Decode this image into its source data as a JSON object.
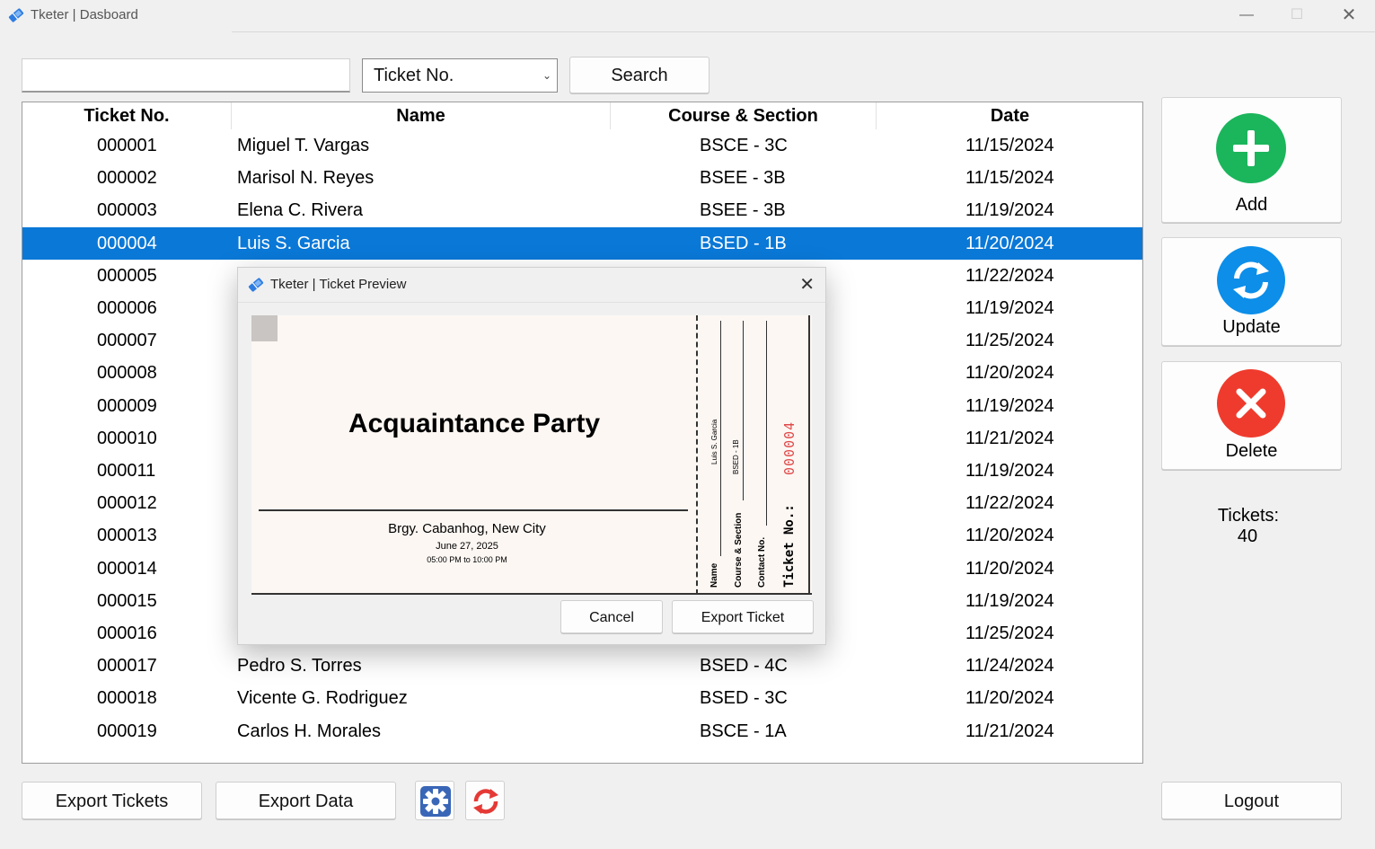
{
  "window": {
    "title": "Tketer | Dasboard"
  },
  "search": {
    "placeholder": "",
    "value": "",
    "filter_selected": "Ticket No.",
    "button": "Search"
  },
  "table": {
    "columns": [
      "Ticket No.",
      "Name",
      "Course & Section",
      "Date"
    ],
    "rows": [
      {
        "no": "000001",
        "name": "Miguel T. Vargas",
        "course": "BSCE - 3C",
        "date": "11/15/2024"
      },
      {
        "no": "000002",
        "name": "Marisol N. Reyes",
        "course": "BSEE - 3B",
        "date": "11/15/2024"
      },
      {
        "no": "000003",
        "name": "Elena C. Rivera",
        "course": "BSEE - 3B",
        "date": "11/19/2024"
      },
      {
        "no": "000004",
        "name": "Luis S. Garcia",
        "course": "BSED - 1B",
        "date": "11/20/2024"
      },
      {
        "no": "000005",
        "name": "",
        "course": "",
        "date": "11/22/2024"
      },
      {
        "no": "000006",
        "name": "",
        "course": "",
        "date": "11/19/2024"
      },
      {
        "no": "000007",
        "name": "",
        "course": "",
        "date": "11/25/2024"
      },
      {
        "no": "000008",
        "name": "",
        "course": "",
        "date": "11/20/2024"
      },
      {
        "no": "000009",
        "name": "",
        "course": "",
        "date": "11/19/2024"
      },
      {
        "no": "000010",
        "name": "",
        "course": "",
        "date": "11/21/2024"
      },
      {
        "no": "000011",
        "name": "",
        "course": "",
        "date": "11/19/2024"
      },
      {
        "no": "000012",
        "name": "",
        "course": "",
        "date": "11/22/2024"
      },
      {
        "no": "000013",
        "name": "",
        "course": "",
        "date": "11/20/2024"
      },
      {
        "no": "000014",
        "name": "",
        "course": "",
        "date": "11/20/2024"
      },
      {
        "no": "000015",
        "name": "",
        "course": "",
        "date": "11/19/2024"
      },
      {
        "no": "000016",
        "name": "",
        "course": "",
        "date": "11/25/2024"
      },
      {
        "no": "000017",
        "name": "Pedro S. Torres",
        "course": "BSED - 4C",
        "date": "11/24/2024"
      },
      {
        "no": "000018",
        "name": "Vicente G. Rodriguez",
        "course": "BSED - 3C",
        "date": "11/20/2024"
      },
      {
        "no": "000019",
        "name": "Carlos H. Morales",
        "course": "BSCE - 1A",
        "date": "11/21/2024"
      }
    ],
    "selected_index": 3
  },
  "actions": {
    "add": "Add",
    "update": "Update",
    "delete": "Delete"
  },
  "tickets": {
    "label": "Tickets:",
    "count": "40"
  },
  "footer": {
    "export_tickets": "Export Tickets",
    "export_data": "Export Data",
    "logout": "Logout"
  },
  "modal": {
    "title": "Tketer | Ticket Preview",
    "ticket": {
      "event": "Acquaintance Party",
      "venue": "Brgy. Cabanhog, New City",
      "date": "June 27, 2025",
      "time": "05:00 PM to 10:00 PM",
      "stub_name_value": "Luis S. Garcia",
      "stub_course_value": "BSED - 1B",
      "stub_name_label": "Name",
      "stub_course_label": "Course & Section",
      "stub_contact_label": "Contact No.",
      "ticket_no_label": "Ticket No.:",
      "ticket_no_value": "000004"
    },
    "cancel": "Cancel",
    "export": "Export Ticket"
  },
  "colors": {
    "accent": "#0a78d7",
    "add": "#1bb55c",
    "update": "#0c8ee9",
    "delete": "#ef3b2d",
    "ticket_no": "#e04a4a"
  }
}
